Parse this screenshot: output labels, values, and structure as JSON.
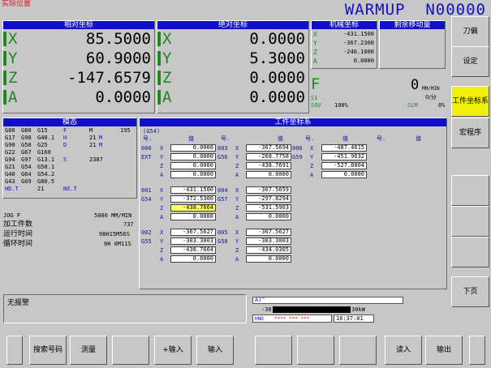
{
  "title_bar": {
    "left": "实际位置",
    "right": "WARMUP  N00000"
  },
  "relative": {
    "header": "相对坐标",
    "rows": [
      {
        "axis": "X",
        "value": "85.5000"
      },
      {
        "axis": "Y",
        "value": "60.9000"
      },
      {
        "axis": "Z",
        "value": "-147.6579"
      },
      {
        "axis": "A",
        "value": "0.0000"
      }
    ]
  },
  "absolute": {
    "header": "绝对坐标",
    "rows": [
      {
        "axis": "X",
        "value": "0.0000"
      },
      {
        "axis": "Y",
        "value": "5.3000"
      },
      {
        "axis": "Z",
        "value": "0.0000"
      },
      {
        "axis": "A",
        "value": "0.0000"
      }
    ]
  },
  "machine": {
    "header": "机械坐标",
    "rows": [
      {
        "axis": "X",
        "value": "-431.1500"
      },
      {
        "axis": "Y",
        "value": "-367.2300"
      },
      {
        "axis": "Z",
        "value": "-246.1000"
      },
      {
        "axis": "A",
        "value": "0.0000"
      }
    ]
  },
  "remaining": {
    "header": "剩余移动量"
  },
  "feed": {
    "letter": "F",
    "value": "0",
    "unit1": "MM/MIN",
    "sub": "0/分",
    "s1": "S1",
    "sov": "SOV",
    "sov_val": "100%",
    "slm": "SLM",
    "slm_val": "0%"
  },
  "modal": {
    "header": "模态",
    "lines": [
      [
        "G00",
        "G80",
        "G15",
        "F",
        "",
        "M",
        "",
        "195"
      ],
      [
        "G17",
        "G98",
        "G40.1",
        "H",
        "",
        "21",
        "M",
        ""
      ],
      [
        "G90",
        "G50",
        "G25",
        "D",
        "",
        "21",
        "M",
        ""
      ],
      [
        "G22",
        "G67",
        "G160",
        "",
        "",
        "",
        "",
        ""
      ],
      [
        "G94",
        "G97",
        "G13.1",
        "S",
        "",
        "2387",
        "",
        ""
      ],
      [
        "G21",
        "G54",
        "G50.1",
        "",
        "",
        "",
        "",
        ""
      ],
      [
        "G40",
        "G64",
        "G54.2",
        "",
        "",
        "",
        "",
        ""
      ],
      [
        "G43",
        "G69",
        "G80.5",
        "",
        "",
        "",
        "",
        ""
      ],
      [
        "HD.T",
        "",
        "21",
        "NX.T",
        "",
        "",
        "",
        ""
      ]
    ]
  },
  "status": {
    "jog": "JOG F",
    "jog_val": "5000 MM/MIN",
    "parts": "加工件数",
    "parts_val": "737",
    "run": "运行时间",
    "run_val": "98H15M56S",
    "cycle": "循环时间",
    "cycle_val": "0H 0M11S"
  },
  "work": {
    "header": "工件坐标系",
    "g54": "(G54)",
    "col_no": "号.",
    "col_val": "值",
    "groups": [
      {
        "left_no": [
          "000",
          "EXT"
        ],
        "mid_no": [
          "003",
          "G56"
        ],
        "right_no": [
          "006",
          "G59"
        ],
        "rows": [
          {
            "ax": "X",
            "l": "0.0000",
            "m": "-367.5694",
            "r": "-487.4615"
          },
          {
            "ax": "Y",
            "l": "0.0000",
            "m": "-268.7758",
            "r": "-451.9632"
          },
          {
            "ax": "Z",
            "l": "0.0000",
            "m": "-438.7691",
            "r": "-527.8804"
          },
          {
            "ax": "A",
            "l": "0.0000",
            "m": "0.0000",
            "r": "0.0000"
          }
        ]
      },
      {
        "left_no": [
          "001",
          "G54"
        ],
        "mid_no": [
          "004",
          "G57"
        ],
        "rows": [
          {
            "ax": "X",
            "l": "-431.1500",
            "m": "-367.5659"
          },
          {
            "ax": "Y",
            "l": "-372.5300",
            "m": "-297.8294"
          },
          {
            "ax": "Z",
            "l": "-438.7664",
            "m": "-531.5963",
            "hl": true
          },
          {
            "ax": "A",
            "l": "0.0000",
            "m": "0.0000"
          }
        ]
      },
      {
        "left_no": [
          "002",
          "G55"
        ],
        "mid_no": [
          "005",
          "G58"
        ],
        "rows": [
          {
            "ax": "X",
            "l": "-367.5627",
            "m": "-367.5627"
          },
          {
            "ax": "Y",
            "l": "-303.3003",
            "m": "-303.3003"
          },
          {
            "ax": "Z",
            "l": "-438.7664",
            "m": "-434.0305"
          },
          {
            "ax": "A",
            "l": "0.0000",
            "m": "0.0000"
          }
        ]
      }
    ]
  },
  "alarm": {
    "text": "无报警"
  },
  "input": {
    "prompt": "A)^",
    "load_left": "-30",
    "load_right": "30kW",
    "mode": "HND",
    "stars": "**** *** ***",
    "time": "16:37:01"
  },
  "side_buttons": [
    "刀偏",
    "设定",
    "工件坐标系",
    "宏程序",
    "",
    "",
    "",
    "下页"
  ],
  "soft_buttons": [
    "",
    "搜索号码",
    "测量",
    "",
    "+输入",
    "输入",
    "",
    "",
    "",
    "读入",
    "输出",
    ""
  ]
}
